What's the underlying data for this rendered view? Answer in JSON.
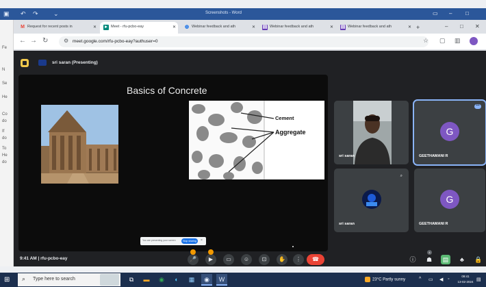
{
  "word": {
    "title": "Screenshots - Word",
    "sidebar_items": [
      "Fe",
      "N",
      "Se",
      "He",
      "Co",
      "do",
      "If",
      "do",
      "To",
      "He",
      "do"
    ]
  },
  "browser": {
    "tabs": [
      {
        "label": "Request for recent posts in",
        "icon": "gmail-icon",
        "color": "#ea4335"
      },
      {
        "label": "Meet - rfu-pcbo-eay",
        "icon": "meet-icon",
        "color": "#00897b",
        "active": true
      },
      {
        "label": "Webinar feedback and ath",
        "icon": "globe-icon",
        "color": "#1a73e8"
      },
      {
        "label": "Webinar feedback and ath",
        "icon": "forms-icon",
        "color": "#673ab7"
      },
      {
        "label": "Webinar feedback and ath",
        "icon": "forms-icon",
        "color": "#673ab7"
      },
      {
        "label": "Webinarfeedback and ath",
        "icon": "sheets-icon",
        "color": "#0f9d58"
      }
    ],
    "url": "meet.google.com/rfu-pcbo-eay?authuser=0"
  },
  "meet": {
    "presenter": "sri saran (Presenting)",
    "slide": {
      "title": "Basics of Concrete",
      "label_cement": "Cement",
      "label_aggregate": "Aggregate"
    },
    "caption_bar": {
      "text": "You are presenting your screen",
      "button": "Stop sharing"
    },
    "participants": [
      {
        "name": "sri saran",
        "type": "video"
      },
      {
        "name": "GEETHAMANI R",
        "initial": "G",
        "speaking": true
      },
      {
        "name": "sri saran",
        "type": "avatar"
      },
      {
        "name": "GEETHAMANI R",
        "initial": "G"
      }
    ],
    "time": "9:41 AM",
    "meeting_code": "rfu-pcbo-eay",
    "people_count": "4"
  },
  "taskbar": {
    "search_placeholder": "Type here to search",
    "weather": "23°C Partly sunny",
    "clock_time": "09:41",
    "clock_date": "13-02-2024"
  }
}
